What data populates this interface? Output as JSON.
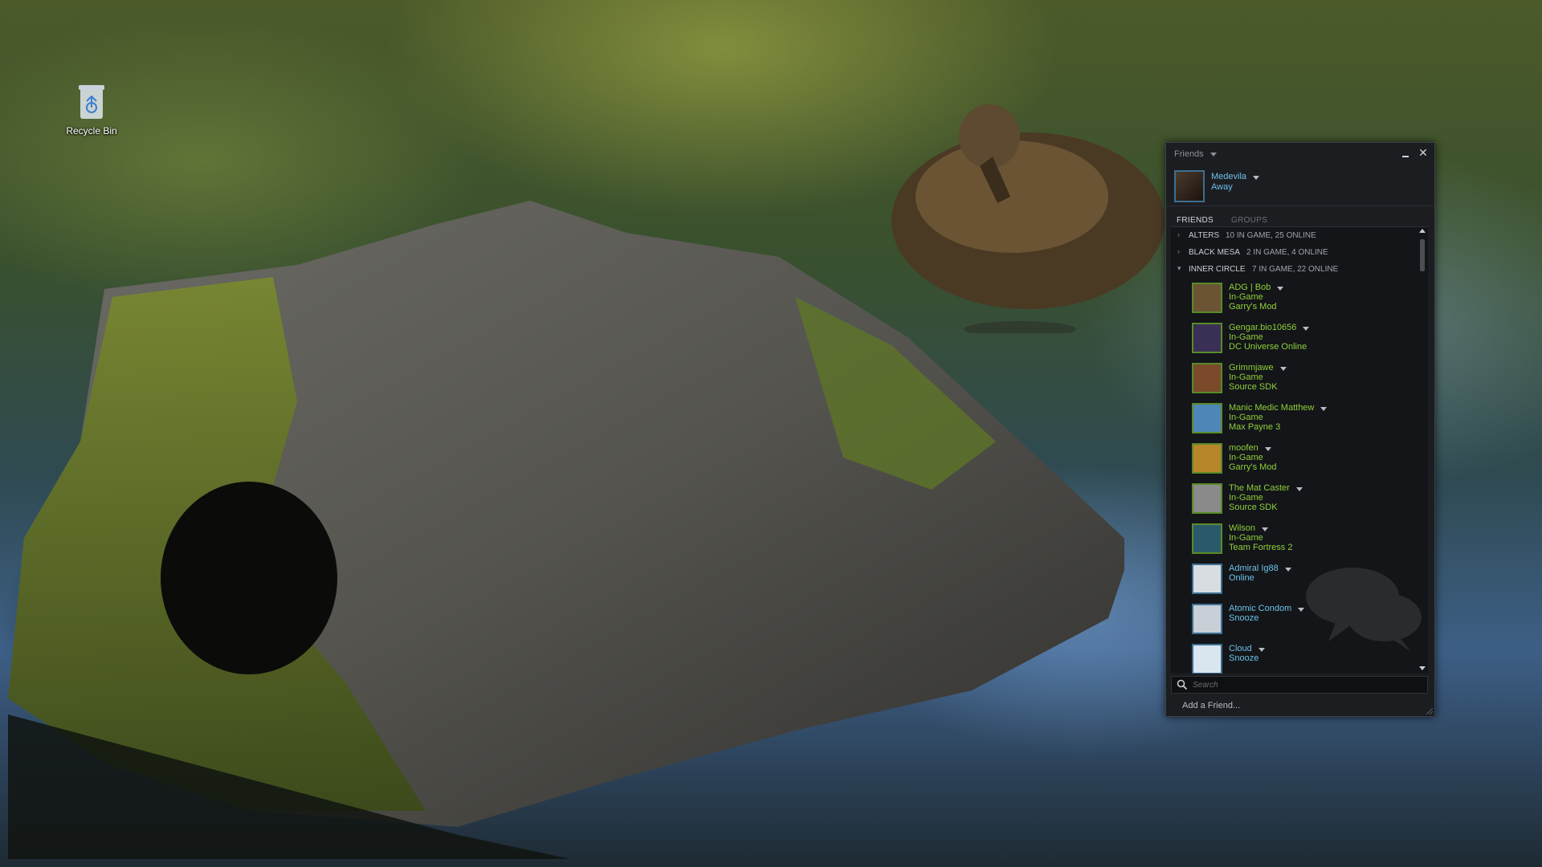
{
  "desktop": {
    "icons": [
      {
        "label": "Recycle Bin",
        "icon": "recycle-bin-icon"
      }
    ]
  },
  "friends_window": {
    "title": "Friends",
    "user": {
      "name": "Medevila",
      "status": "Away"
    },
    "tabs": [
      "FRIENDS",
      "GROUPS"
    ],
    "groups": [
      {
        "name": "ALTERS",
        "count": "10 IN GAME, 25 ONLINE",
        "expanded": false
      },
      {
        "name": "BLACK MESA",
        "count": "2 IN GAME, 4 ONLINE",
        "expanded": false
      },
      {
        "name": "INNER CIRCLE",
        "count": "7 IN GAME, 22 ONLINE",
        "expanded": true
      }
    ],
    "friends": [
      {
        "name": "ADG | Bob",
        "status": "In-Game",
        "game": "Garry's Mod",
        "avatar_color": "#6b5433"
      },
      {
        "name": "Gengar.bio10656",
        "status": "In-Game",
        "game": "DC Universe Online",
        "avatar_color": "#3a2f55"
      },
      {
        "name": "Grimmjawe",
        "status": "In-Game",
        "game": "Source SDK",
        "avatar_color": "#7a4a2a"
      },
      {
        "name": "Manic Medic Matthew",
        "status": "In-Game",
        "game": "Max Payne 3",
        "avatar_color": "#4f86b8"
      },
      {
        "name": "moofen",
        "status": "In-Game",
        "game": "Garry's Mod",
        "avatar_color": "#b8862a"
      },
      {
        "name": "The Mat Caster",
        "status": "In-Game",
        "game": "Source SDK",
        "avatar_color": "#8a8a8a"
      },
      {
        "name": "Wilson",
        "status": "In-Game",
        "game": "Team Fortress 2",
        "avatar_color": "#2a5a6a"
      },
      {
        "name": "Admiral Ig88",
        "status": "Online",
        "game": "",
        "avatar_color": "#d8dde2"
      },
      {
        "name": "Atomic Condom",
        "status": "Snooze",
        "game": "",
        "avatar_color": "#c9cfd6"
      },
      {
        "name": "Cloud",
        "status": "Snooze",
        "game": "",
        "avatar_color": "#d9e6f0"
      }
    ],
    "search_placeholder": "Search",
    "add_friend_label": "Add a Friend..."
  },
  "colors": {
    "in_game": "#8fcf3a",
    "online": "#6dc1e8",
    "window_bg": "#1b1d21"
  }
}
